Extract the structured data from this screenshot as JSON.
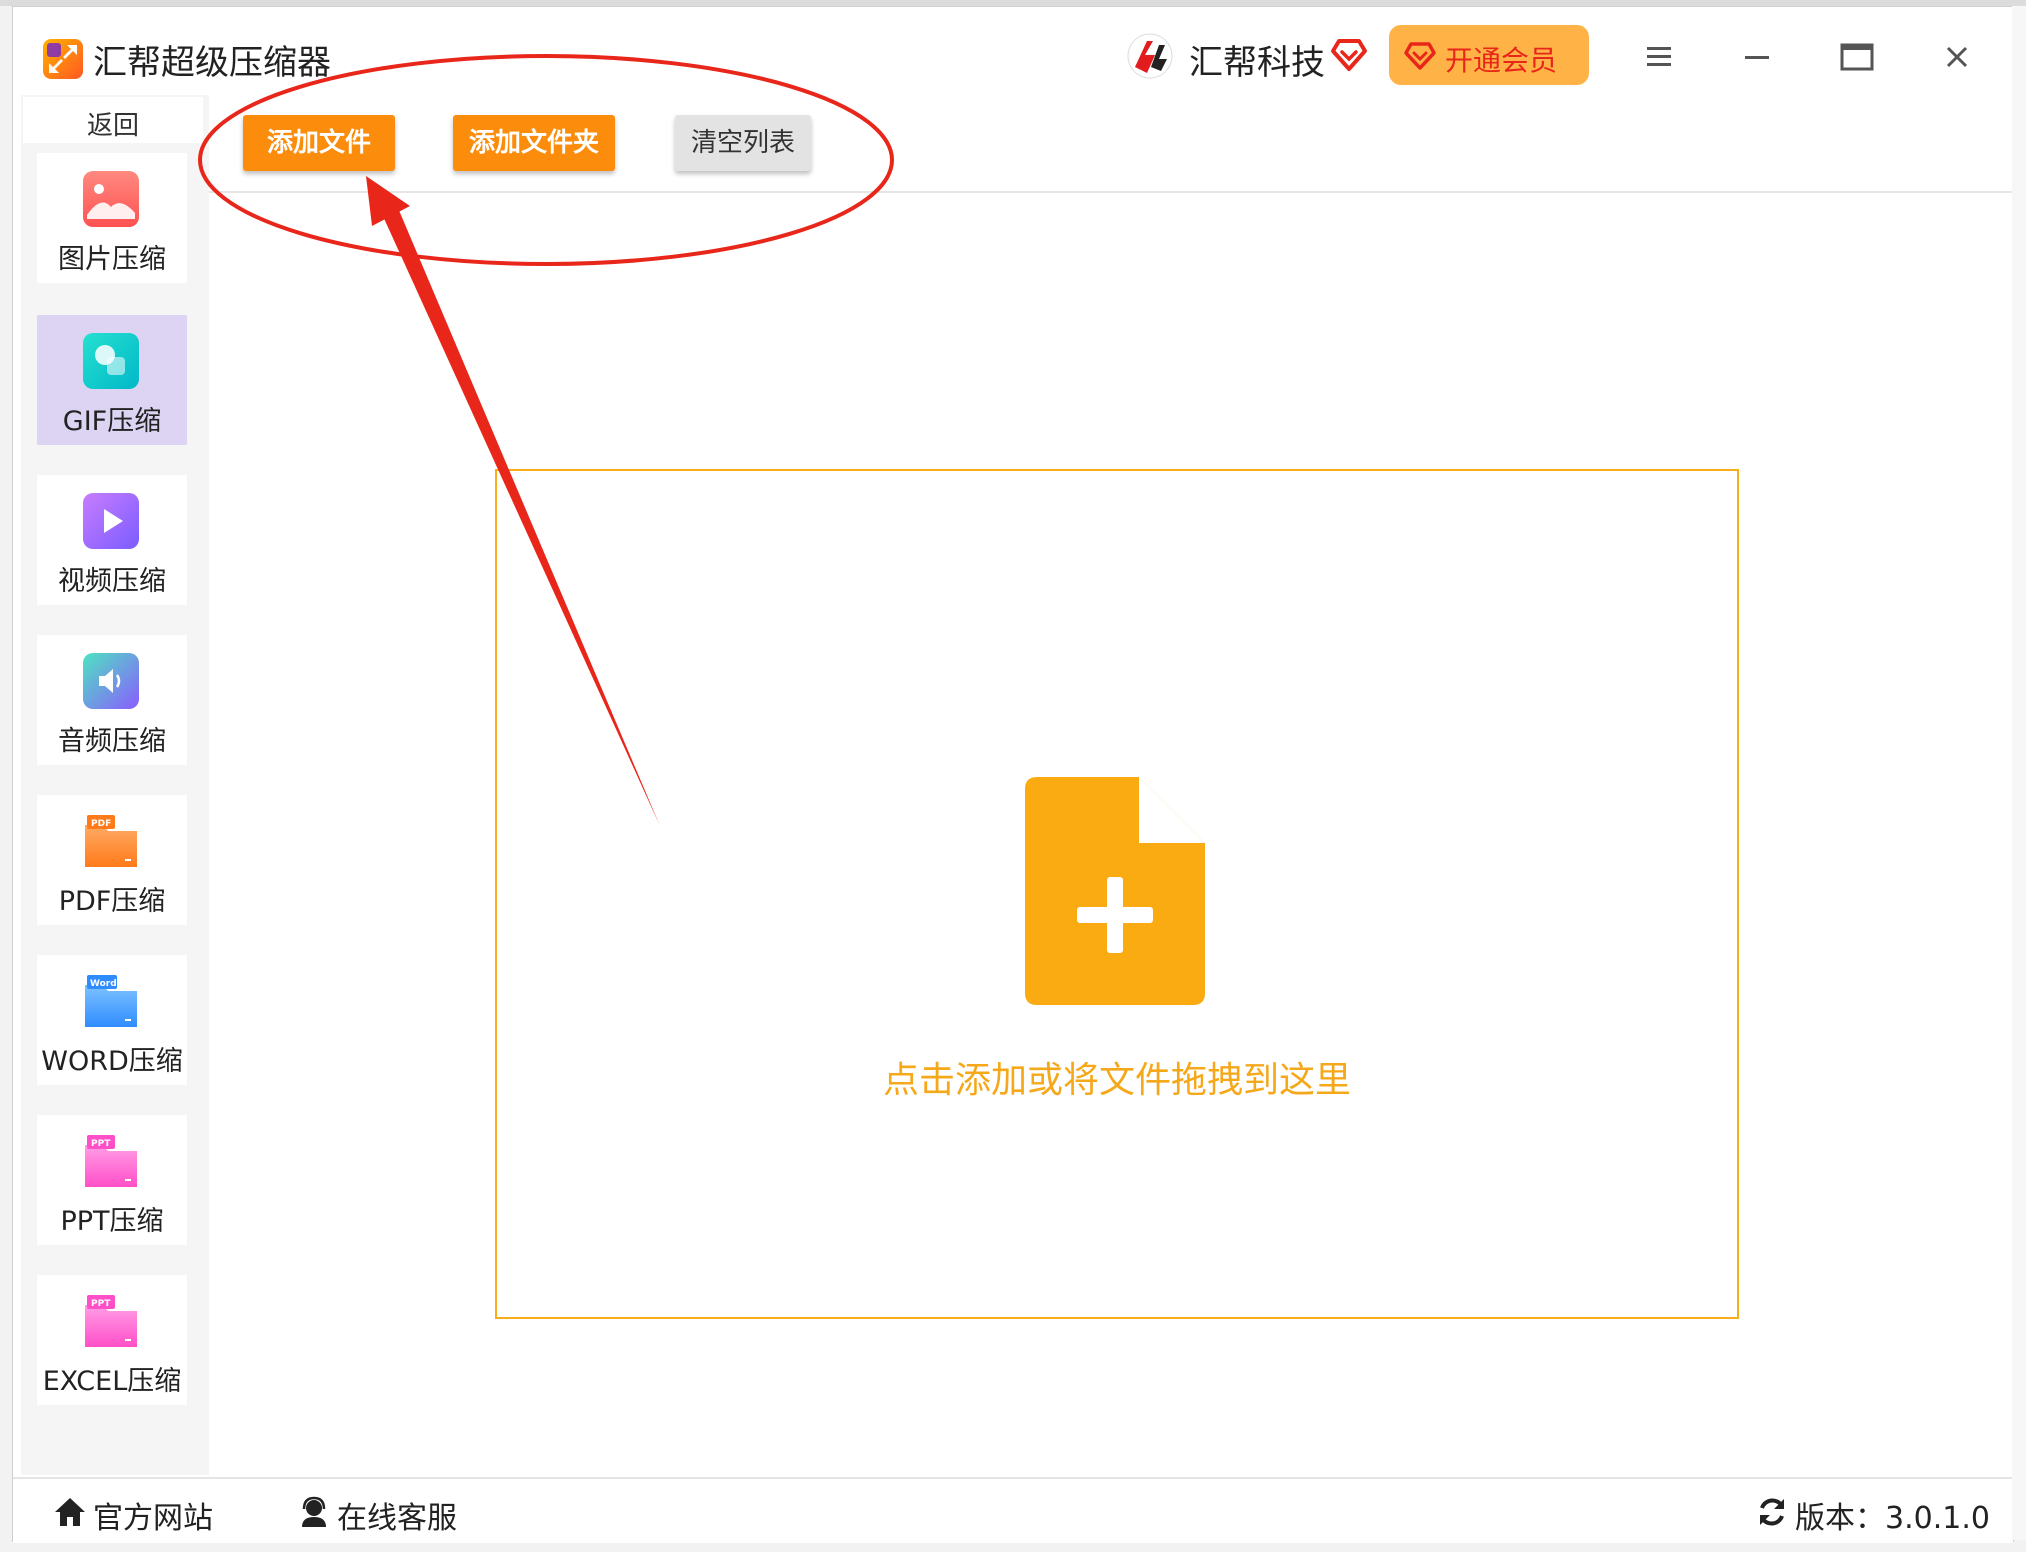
{
  "app": {
    "title": "汇帮超级压缩器",
    "brand": "汇帮科技",
    "vip_label": "开通会员"
  },
  "sidebar": {
    "back_label": "返回",
    "items": [
      {
        "label": "图片压缩",
        "icon": "image-icon",
        "active": false
      },
      {
        "label": "GIF压缩",
        "icon": "gif-icon",
        "active": true
      },
      {
        "label": "视频压缩",
        "icon": "video-icon",
        "active": false
      },
      {
        "label": "音频压缩",
        "icon": "audio-icon",
        "active": false
      },
      {
        "label": "PDF压缩",
        "icon": "pdf-icon",
        "badge": "PDF",
        "active": false
      },
      {
        "label": "WORD压缩",
        "icon": "word-icon",
        "badge": "Word",
        "active": false
      },
      {
        "label": "PPT压缩",
        "icon": "ppt-icon",
        "badge": "PPT",
        "active": false
      },
      {
        "label": "EXCEL压缩",
        "icon": "excel-icon",
        "badge": "PPT",
        "active": false
      }
    ]
  },
  "toolbar": {
    "add_file": "添加文件",
    "add_folder": "添加文件夹",
    "clear_list": "清空列表"
  },
  "dropzone": {
    "text": "点击添加或将文件拖拽到这里"
  },
  "footer": {
    "website": "官方网站",
    "support": "在线客服",
    "version": "版本：3.0.1.0"
  },
  "colors": {
    "accent_orange": "#fb8c0c",
    "drop_border": "#f9ad18",
    "annotation_red": "#e8261a",
    "active_item": "#ddd4f4"
  }
}
